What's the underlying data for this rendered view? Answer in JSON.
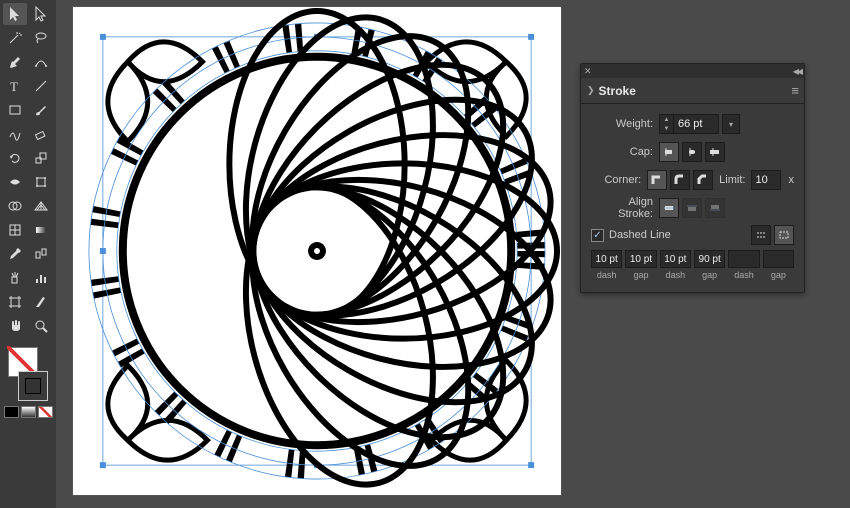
{
  "panel": {
    "title": "Stroke",
    "weight_label": "Weight:",
    "weight_value": "66 pt",
    "cap_label": "Cap:",
    "corner_label": "Corner:",
    "limit_label": "Limit:",
    "limit_value": "10",
    "limit_suffix": "x",
    "align_label": "Align Stroke:",
    "dashed_label": "Dashed Line",
    "dashed_checked": "✓",
    "dash_values": [
      "10 pt",
      "10 pt",
      "10 pt",
      "90 pt",
      "",
      ""
    ],
    "dash_labels": [
      "dash",
      "gap",
      "dash",
      "gap",
      "dash",
      "gap"
    ]
  },
  "tools": {
    "fill_none": true,
    "stroke_color": "#000000"
  }
}
